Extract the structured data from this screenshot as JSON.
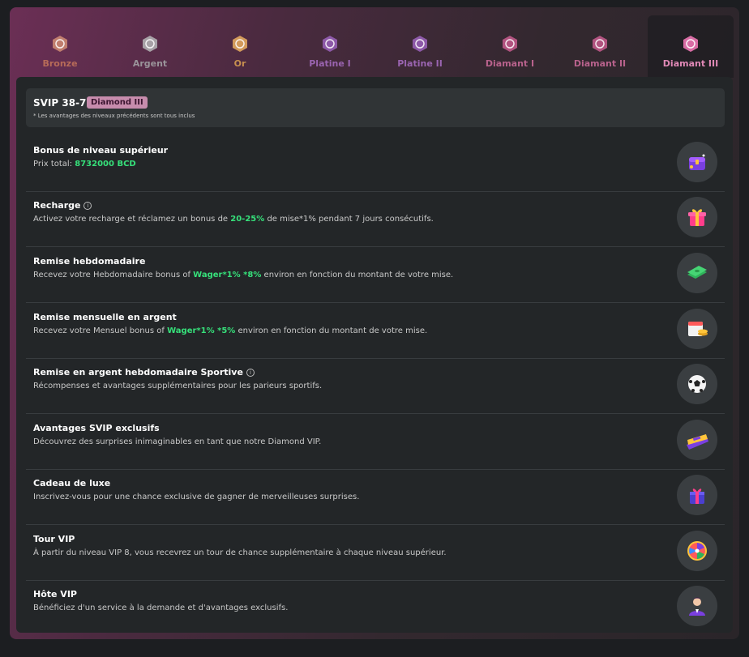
{
  "tabs": [
    {
      "label": "Bronze",
      "color": "#b76b58",
      "badge": "#c07e6e"
    },
    {
      "label": "Argent",
      "color": "#9a949a",
      "badge": "#a7a1a6"
    },
    {
      "label": "Or",
      "color": "#c8904f",
      "badge": "#d29a5b"
    },
    {
      "label": "Platine I",
      "color": "#9a64b0",
      "badge": "#8d59a8"
    },
    {
      "label": "Platine II",
      "color": "#9a64b0",
      "badge": "#8d59a8"
    },
    {
      "label": "Diamant I",
      "color": "#b8628c",
      "badge": "#b1537f"
    },
    {
      "label": "Diamant II",
      "color": "#b8628c",
      "badge": "#b1537f"
    },
    {
      "label": "Diamant III",
      "color": "#e088b6",
      "badge": "#d86ca4",
      "active": true
    }
  ],
  "level": {
    "title": "SVIP 38-75",
    "tag": "Diamond III",
    "note": "* Les avantages des niveaux précédents sont tous inclus"
  },
  "rows": [
    {
      "title": "Bonus de niveau supérieur",
      "desc_pre": "Prix total: ",
      "hl": "8732000 BCD",
      "desc_post": "",
      "icon": "treasure-chest-icon"
    },
    {
      "title": "Recharge",
      "info": "i",
      "desc_pre": "Activez votre recharge et réclamez un bonus de ",
      "hl": "20-25%",
      "desc_post": " de mise*1% pendant 7 jours consécutifs.",
      "icon": "gift-box-icon"
    },
    {
      "title": "Remise hebdomadaire",
      "desc_pre": "Recevez votre Hebdomadaire bonus of ",
      "hl": "Wager*1% *8%",
      "desc_post": " environ en fonction du montant de votre mise.",
      "icon": "cash-stack-icon"
    },
    {
      "title": "Remise mensuelle en argent",
      "desc_pre": "Recevez votre Mensuel bonus of ",
      "hl": "Wager*1% *5%",
      "desc_post": " environ en fonction du montant de votre mise.",
      "icon": "calendar-coins-icon"
    },
    {
      "title": "Remise en argent hebdomadaire Sportive",
      "info": "i",
      "desc_pre": "Récompenses et avantages supplémentaires pour les parieurs sportifs.",
      "hl": "",
      "desc_post": "",
      "icon": "soccer-ball-icon"
    },
    {
      "title": "Avantages SVIP exclusifs",
      "desc_pre": "Découvrez des surprises inimaginables en tant que notre Diamond VIP.",
      "hl": "",
      "desc_post": "",
      "icon": "svip-ticket-icon"
    },
    {
      "title": "Cadeau de luxe",
      "desc_pre": "Inscrivez-vous pour une chance exclusive de gagner de merveilleuses surprises.",
      "hl": "",
      "desc_post": "",
      "icon": "luxury-gift-icon"
    },
    {
      "title": "Tour VIP",
      "desc_pre": "À partir du niveau VIP 8, vous recevrez un tour de chance supplémentaire à chaque niveau supérieur.",
      "hl": "",
      "desc_post": "",
      "icon": "prize-wheel-icon"
    },
    {
      "title": "Hôte VIP",
      "desc_pre": "Bénéficiez d'un service à la demande et d'avantages exclusifs.",
      "hl": "",
      "desc_post": "",
      "icon": "vip-host-icon"
    }
  ]
}
